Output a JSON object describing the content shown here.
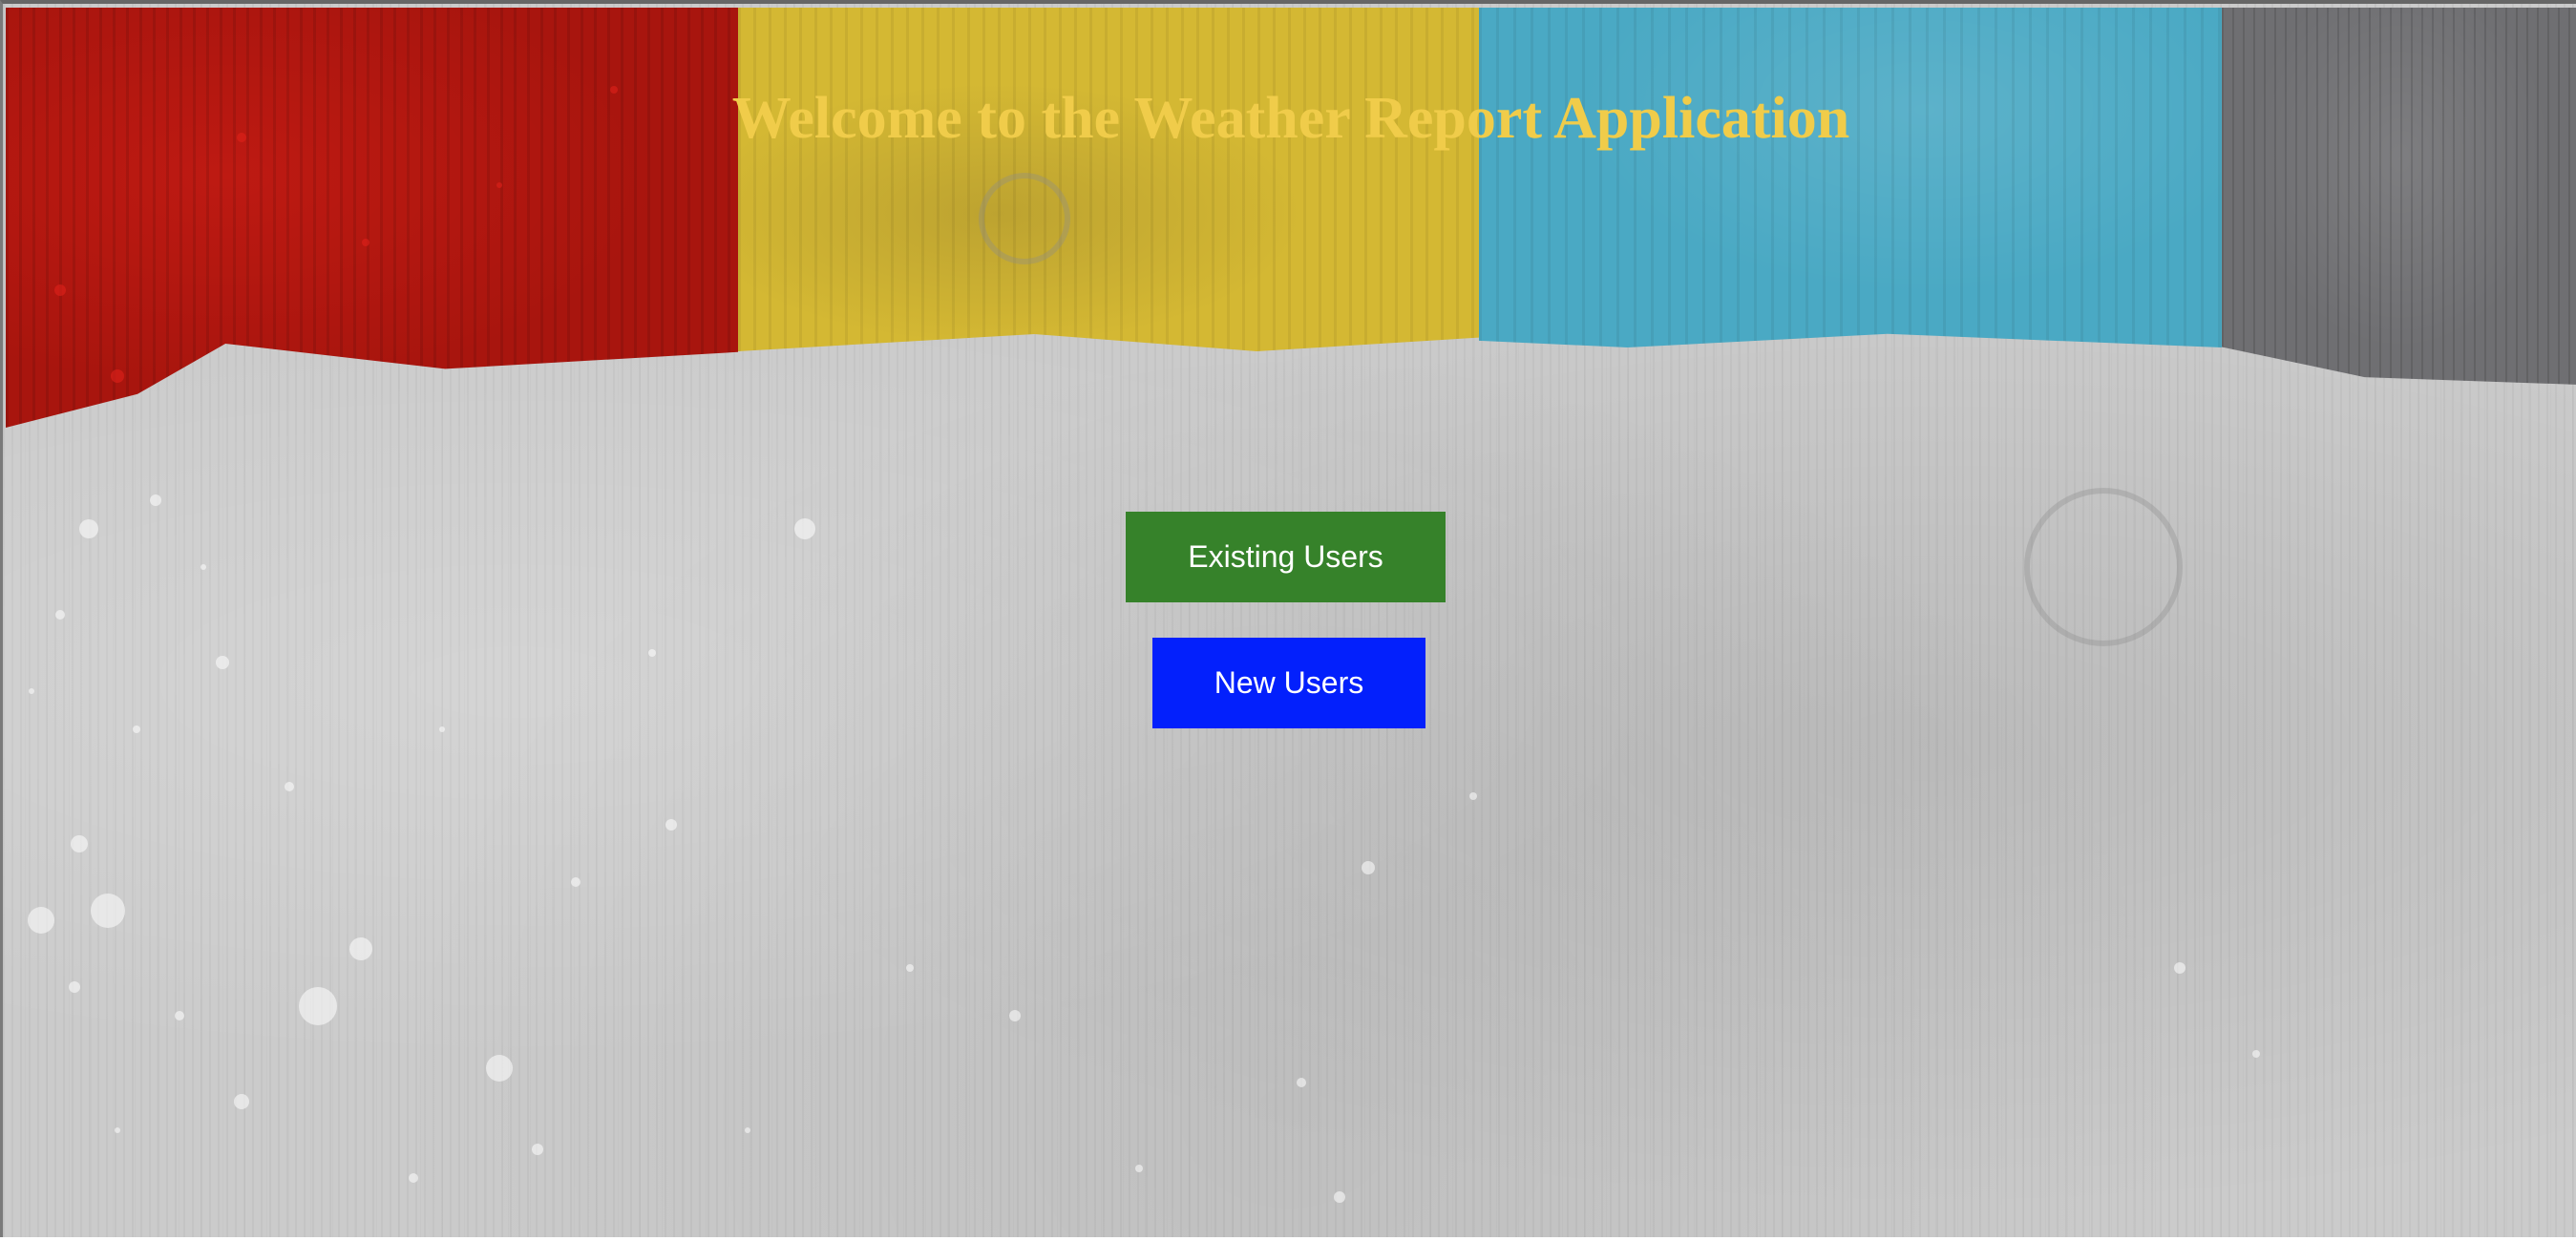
{
  "page": {
    "title": "Welcome to the Weather Report Application"
  },
  "buttons": {
    "existing_users": "Existing Users",
    "new_users": "New Users"
  },
  "colors": {
    "title": "#f0cc4a",
    "existing_users_button": "#36822a",
    "new_users_button": "#0320fc",
    "stripe_red": "#a8150e",
    "stripe_yellow": "#d4b833",
    "stripe_blue": "#4aa9c4",
    "stripe_gray": "#6f6f72",
    "background": "#cbcbcb"
  }
}
